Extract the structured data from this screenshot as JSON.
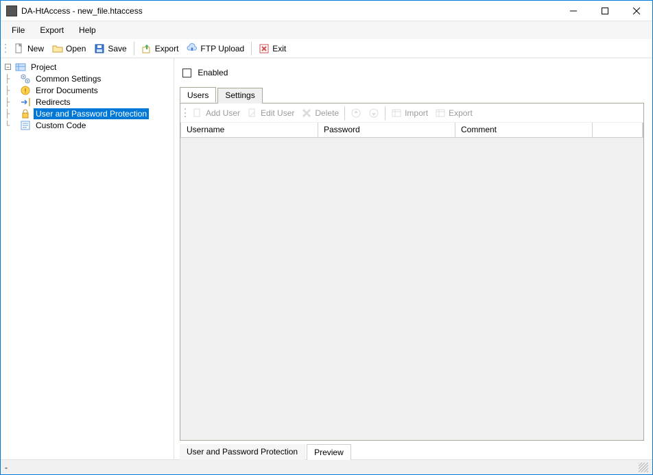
{
  "window": {
    "title": "DA-HtAccess - new_file.htaccess"
  },
  "menus": {
    "file": "File",
    "export": "Export",
    "help": "Help"
  },
  "toolbar": {
    "new": "New",
    "open": "Open",
    "save": "Save",
    "export": "Export",
    "ftp": "FTP Upload",
    "exit": "Exit"
  },
  "tree": {
    "root": "Project",
    "items": {
      "common": "Common Settings",
      "error": "Error Documents",
      "redirects": "Redirects",
      "userpass": "User and Password Protection",
      "custom": "Custom Code"
    }
  },
  "panel": {
    "enabled_label": "Enabled",
    "tabs": {
      "users": "Users",
      "settings": "Settings"
    },
    "user_toolbar": {
      "add": "Add User",
      "edit": "Edit User",
      "delete": "Delete",
      "import": "Import",
      "export": "Export"
    },
    "columns": {
      "username": "Username",
      "password": "Password",
      "comment": "Comment"
    }
  },
  "bottom_tabs": {
    "main": "User and Password Protection",
    "preview": "Preview"
  },
  "statusbar": {
    "text": "-"
  }
}
